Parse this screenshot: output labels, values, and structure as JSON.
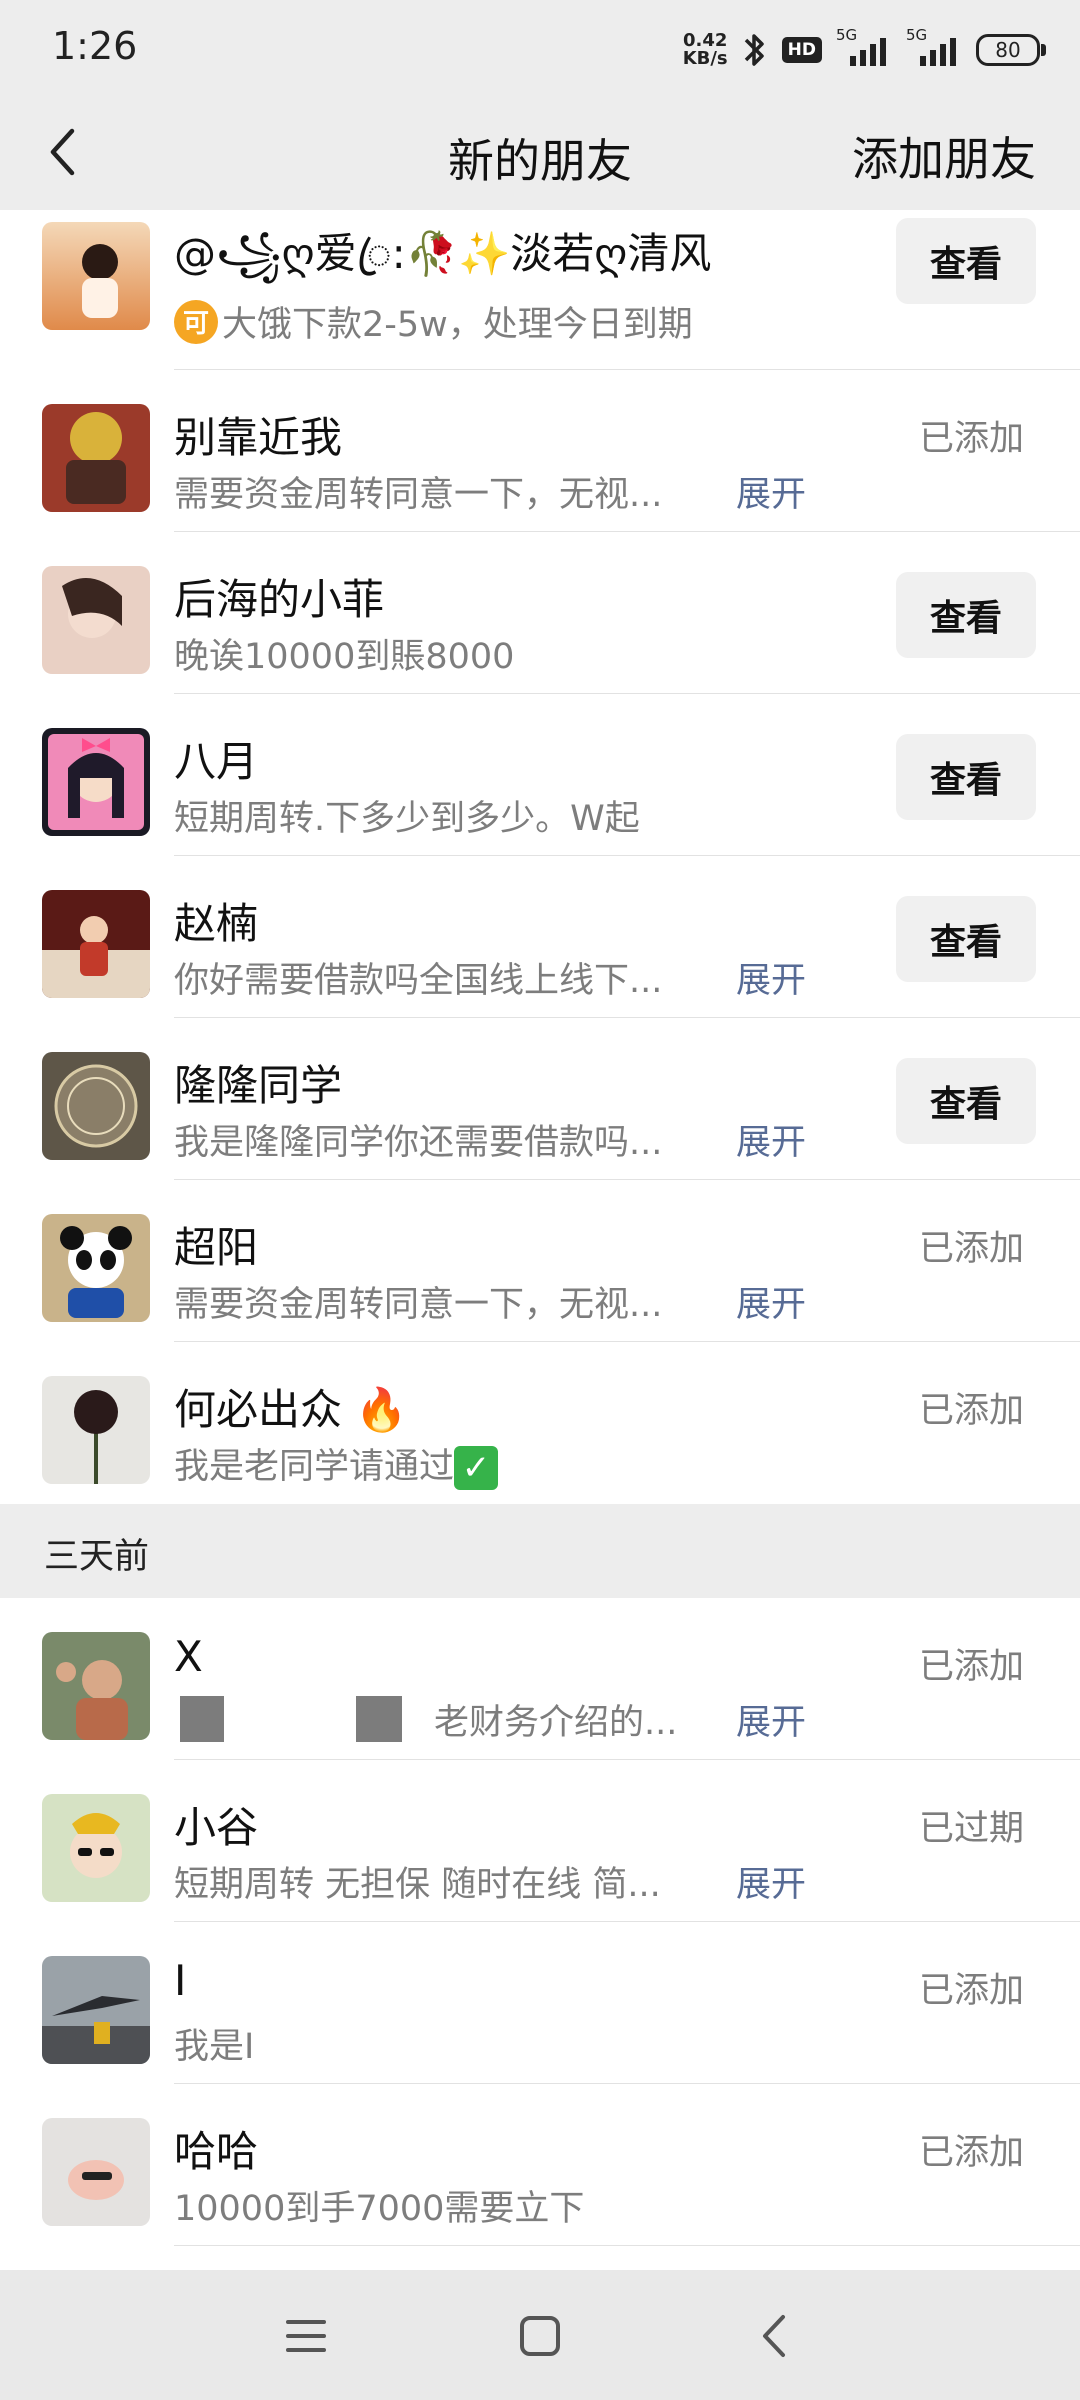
{
  "status_bar": {
    "time": "1:26",
    "net_speed_value": "0.42",
    "net_speed_unit": "KB/s",
    "hd_label": "HD",
    "signal1_label": "5G",
    "signal2_label": "5G",
    "battery": "80"
  },
  "nav": {
    "title": "新的朋友",
    "action": "添加朋友"
  },
  "rows": [
    {
      "name": "@꧁ღ爱ꦿ:🥀✨淡若ღ清风",
      "message": "大饿下款2-5w，处理今日到期",
      "action": "查看"
    },
    {
      "name": "别靠近我",
      "message": "需要资金周转同意一下，无视...",
      "expand": "展开",
      "status": "已添加"
    },
    {
      "name": "后海的小菲",
      "message": "晚诶10000到賬8000",
      "action": "查看"
    },
    {
      "name": "八月",
      "message": "短期周转.下多少到多少。W起",
      "action": "查看"
    },
    {
      "name": "赵楠",
      "message": "你好需要借款吗全国线上线下...",
      "expand": "展开",
      "action": "查看"
    },
    {
      "name": "隆隆同学",
      "message": "我是隆隆同学你还需要借款吗...",
      "expand": "展开",
      "action": "查看"
    },
    {
      "name": "超阳",
      "message": "需要资金周转同意一下，无视...",
      "expand": "展开",
      "status": "已添加"
    },
    {
      "name": "何必出众",
      "message": "我是老同学请通过",
      "status": "已添加"
    }
  ],
  "section_label": "三天前",
  "rows_older": [
    {
      "name": "X",
      "message": "老财务介绍的...",
      "expand": "展开",
      "status": "已添加"
    },
    {
      "name": "小谷",
      "message": "短期周转 无担保 随时在线 简...",
      "expand": "展开",
      "status": "已过期"
    },
    {
      "name": "I",
      "message": "我是I",
      "status": "已添加"
    },
    {
      "name": "哈哈",
      "message": "10000到手7000需要立下",
      "status": "已添加"
    }
  ],
  "coin_glyph": "可",
  "colors": {
    "link": "#576b95",
    "header_bg": "#ededed",
    "secondary_text": "#7d7d7d"
  },
  "icons": [
    "back-icon",
    "menu-icon",
    "home-icon",
    "nav-back-icon",
    "bluetooth-icon",
    "fire-icon",
    "check-icon"
  ]
}
